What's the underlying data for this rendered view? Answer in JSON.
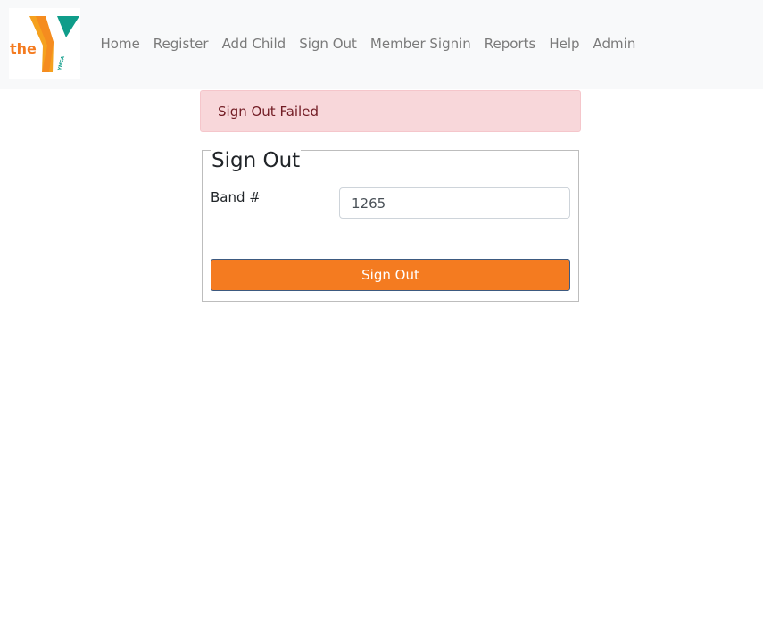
{
  "logo": {
    "text": "the",
    "brand": "YMCA",
    "icon": "ymca-y-logo"
  },
  "nav": {
    "items": [
      {
        "label": "Home"
      },
      {
        "label": "Register"
      },
      {
        "label": "Add Child"
      },
      {
        "label": "Sign Out"
      },
      {
        "label": "Member Signin"
      },
      {
        "label": "Reports"
      },
      {
        "label": "Help"
      },
      {
        "label": "Admin"
      }
    ]
  },
  "alert": {
    "message": "Sign Out Failed"
  },
  "form": {
    "legend": "Sign Out",
    "band_label": "Band #",
    "band_value": "1265",
    "submit_label": "Sign Out"
  },
  "colors": {
    "accent_orange": "#f47b20",
    "logo_teal": "#0f9d8a",
    "alert_bg": "#f8d7da",
    "alert_text": "#721c24"
  }
}
